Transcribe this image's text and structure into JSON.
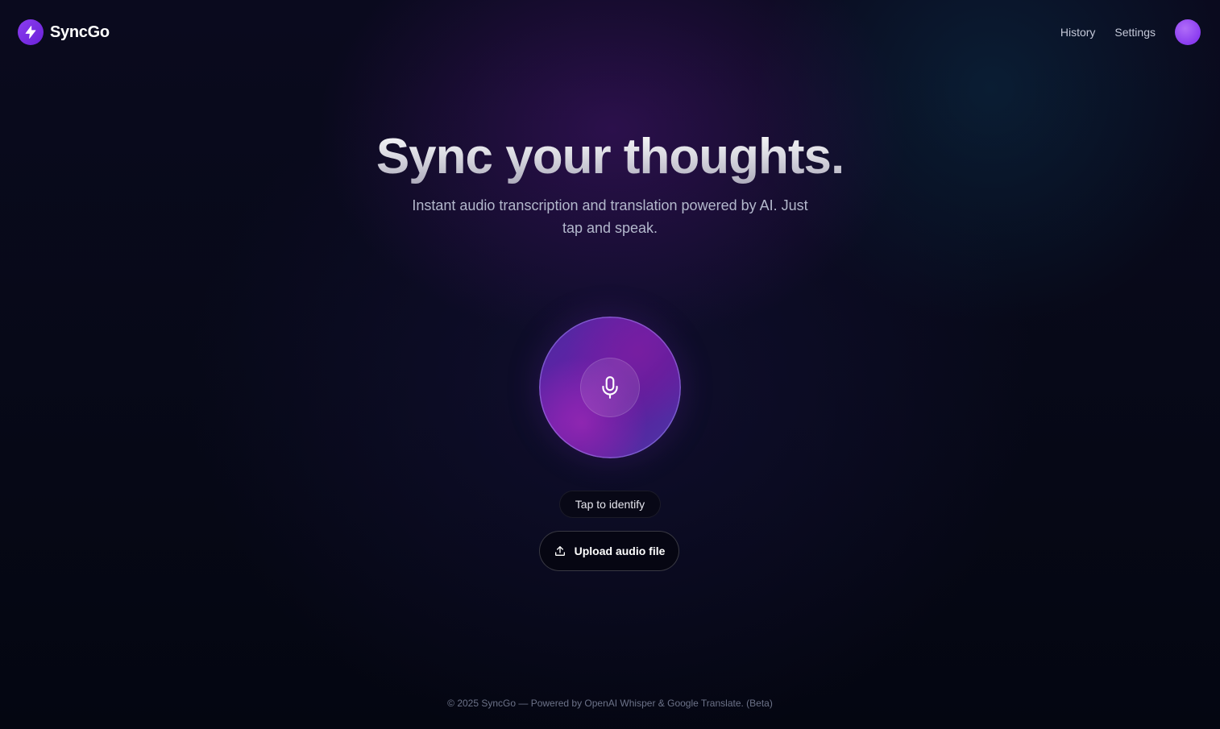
{
  "header": {
    "brand_name": "SyncGo",
    "logo_icon": "lightning-bolt-icon",
    "nav": {
      "history": "History",
      "settings": "Settings"
    }
  },
  "hero": {
    "title": "Sync your thoughts.",
    "subtitle": "Instant audio transcription and translation powered by AI. Just tap and speak."
  },
  "recorder": {
    "mic_icon": "microphone-icon",
    "tap_label": "Tap to identify",
    "upload_label": "Upload audio file",
    "upload_icon": "upload-icon"
  },
  "footer": {
    "text": "© 2025 SyncGo — Powered by OpenAI Whisper & Google Translate. (Beta)"
  },
  "colors": {
    "background": "#060814",
    "accent": "#8b3df0",
    "orb_purple": "#6a1ea8",
    "text_muted": "#b3b8cc"
  }
}
